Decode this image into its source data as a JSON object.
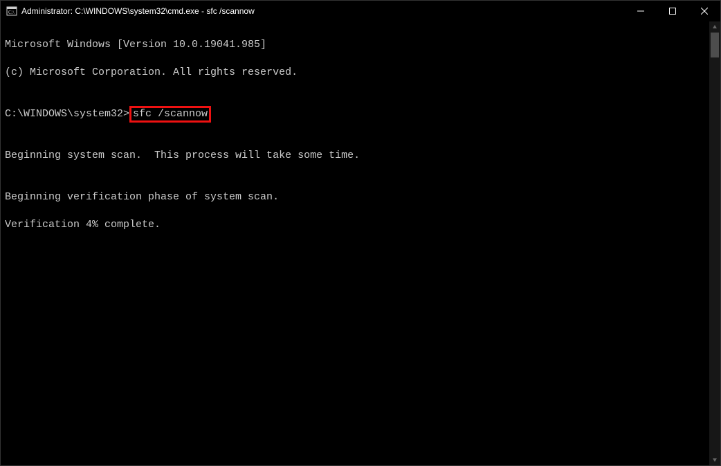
{
  "titlebar": {
    "text": "Administrator: C:\\WINDOWS\\system32\\cmd.exe - sfc  /scannow"
  },
  "terminal": {
    "line1": "Microsoft Windows [Version 10.0.19041.985]",
    "line2": "(c) Microsoft Corporation. All rights reserved.",
    "blank1": "",
    "prompt": "C:\\WINDOWS\\system32>",
    "command": "sfc /scannow",
    "blank2": "",
    "line3": "Beginning system scan.  This process will take some time.",
    "blank3": "",
    "line4": "Beginning verification phase of system scan.",
    "line5": "Verification 4% complete."
  }
}
